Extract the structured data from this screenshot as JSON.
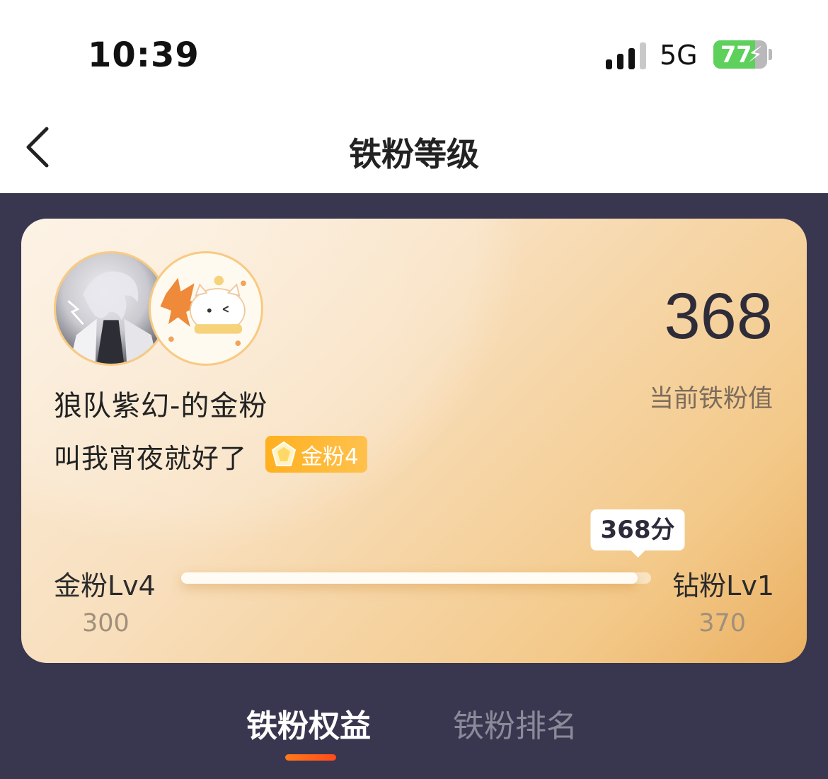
{
  "status_bar": {
    "time": "10:39",
    "network": "5G",
    "battery": "77",
    "battery_level": 0.77,
    "signal_icon": "signal-bars-icon",
    "battery_icon": "battery-charging-icon"
  },
  "header": {
    "title": "铁粉等级",
    "back_icon": "chevron-left-icon"
  },
  "card": {
    "name": "狼队紫幻-的金粉",
    "nickname": "叫我宵夜就好了",
    "badge_label": "金粉4",
    "badge_icon": "gem-icon",
    "score": "368",
    "score_label": "当前铁粉值",
    "progress": {
      "current_label": "368分",
      "current_value": 368,
      "start_value": 300,
      "end_value": 370,
      "start_level": "金粉Lv4",
      "end_level": "钻粉Lv1",
      "start_value_text": "300",
      "end_value_text": "370"
    }
  },
  "tabs": [
    {
      "label": "铁粉权益",
      "active": true
    },
    {
      "label": "铁粉排名",
      "active": false
    }
  ],
  "colors": {
    "accent": "#ff6a1a",
    "background": "#393750",
    "badge": "#ffb01f"
  }
}
